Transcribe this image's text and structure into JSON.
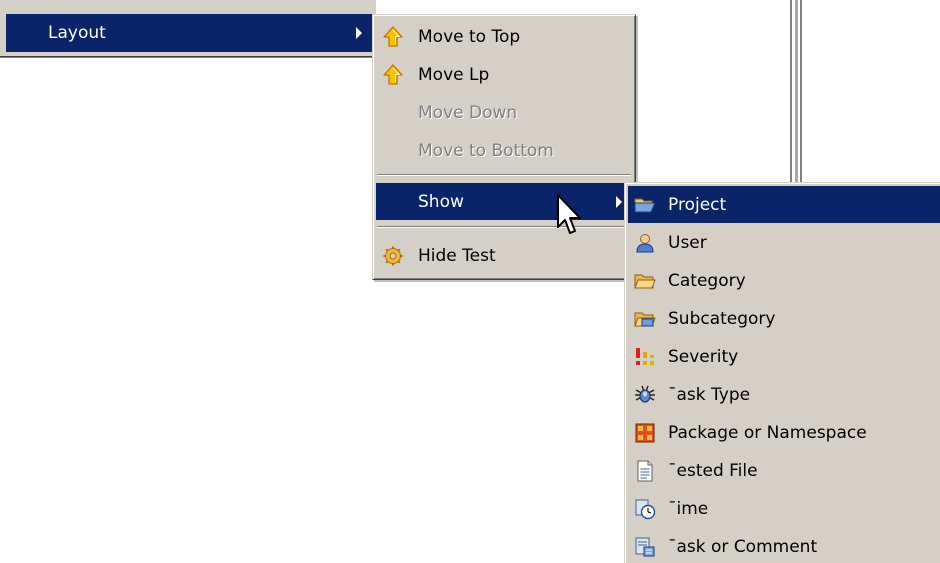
{
  "parent_menu": {
    "item": {
      "label": "Layout",
      "icon": "none",
      "has_submenu": true,
      "selected": true
    }
  },
  "layout_menu": {
    "items": [
      {
        "label": "Move to Top",
        "icon": "up-arrow-icon",
        "enabled": true
      },
      {
        "label": "Move Lp",
        "icon": "up-arrow-icon",
        "enabled": true
      },
      {
        "label": "Move Down",
        "icon": "none",
        "enabled": false
      },
      {
        "label": "Move to Bottom",
        "icon": "none",
        "enabled": false
      },
      {
        "label": "Show",
        "icon": "none",
        "enabled": true,
        "has_submenu": true,
        "selected": true
      },
      {
        "label": "Hide Test",
        "icon": "gear-icon",
        "enabled": true
      }
    ]
  },
  "show_menu": {
    "items": [
      {
        "label": "Project",
        "icon": "folder-open-icon",
        "selected": true
      },
      {
        "label": "User",
        "icon": "user-icon"
      },
      {
        "label": "Category",
        "icon": "folder-icon"
      },
      {
        "label": "Subcategory",
        "icon": "subfolder-icon"
      },
      {
        "label": "Severity",
        "icon": "severity-icon"
      },
      {
        "label": "¯ask Type",
        "icon": "bug-icon"
      },
      {
        "label": "Package or Namespace",
        "icon": "package-icon"
      },
      {
        "label": "¯ested File",
        "icon": "file-icon"
      },
      {
        "label": "¯ime",
        "icon": "clock-icon"
      },
      {
        "label": "¯ask or Comment",
        "icon": "comment-icon"
      }
    ]
  },
  "colors": {
    "menu_bg": "#d4d0c8",
    "selection_bg": "#0a246a",
    "selection_fg": "#ffffff",
    "disabled_fg": "#808080",
    "arrow_yellow": "#f5b700",
    "arrow_orange": "#e07b00"
  }
}
